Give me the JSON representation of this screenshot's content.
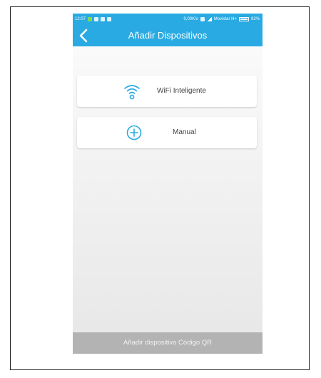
{
  "status_bar": {
    "time": "12:07",
    "net_speed": "0,00K/s",
    "carrier": "Movistar H+",
    "battery": "92%"
  },
  "app_bar": {
    "title": "Añadir Dispositivos",
    "back_icon": "chevron-left-icon"
  },
  "options": [
    {
      "label": "WiFi Inteligente",
      "icon": "wifi-icon"
    },
    {
      "label": "Manual",
      "icon": "plus-circle-icon"
    }
  ],
  "bottom_bar": {
    "label": "Añadir dispositivo Código QR"
  },
  "colors": {
    "accent": "#29aae2",
    "bottom_bar": "#b3b3b3",
    "background": "#f0f0f0"
  }
}
